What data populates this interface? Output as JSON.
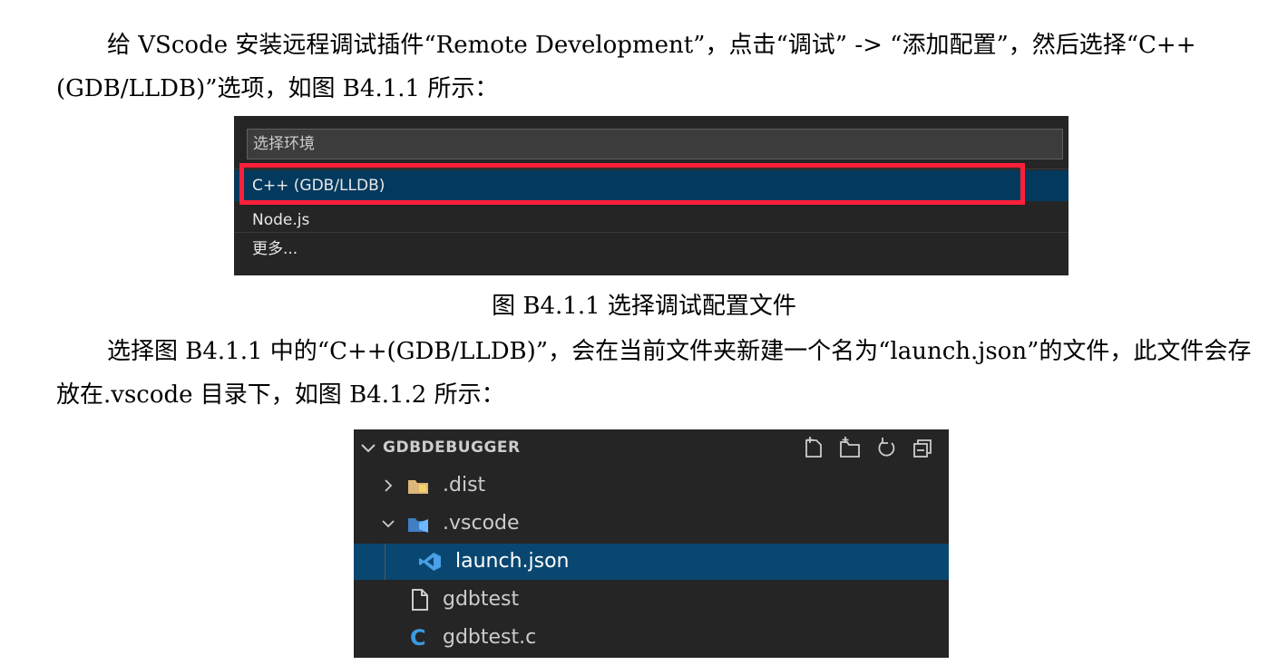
{
  "para1": "给 VScode 安装远程调试插件“Remote Development”，点击“调试” -> “添加配置”，然后选择“C++(GDB/LLDB)”选项，如图 B4.1.1 所示：",
  "figure1": {
    "placeholder": "选择环境",
    "items": [
      "C++ (GDB/LLDB)",
      "Node.js",
      "更多..."
    ],
    "highlight_color": "#ff1f3a",
    "selected_bg": "#04395e"
  },
  "caption1": "图 B4.1.1  选择调试配置文件",
  "para2": "选择图 B4.1.1 中的“C++(GDB/LLDB)”，会在当前文件夹新建一个名为“launch.json”的文件，此文件会存放在.vscode 目录下，如图 B4.1.2 所示：",
  "figure2": {
    "title": "GDBDEBUGGER",
    "actions": [
      "new-file-icon",
      "new-folder-icon",
      "refresh-icon",
      "collapse-all-icon"
    ],
    "tree": [
      {
        "label": ".dist",
        "icon": "folder-icon",
        "twisty": ">"
      },
      {
        "label": ".vscode",
        "icon": "vscode-folder-icon",
        "twisty": "v"
      },
      {
        "label": "launch.json",
        "icon": "vscode-json-icon",
        "selected": true
      },
      {
        "label": "gdbtest",
        "icon": "file-icon"
      },
      {
        "label": "gdbtest.c",
        "icon": "c-file-icon"
      }
    ],
    "selected_bg": "#094771",
    "c_icon_color": "#3b9ae1",
    "vscode_icon_color": "#4a9fe8"
  }
}
